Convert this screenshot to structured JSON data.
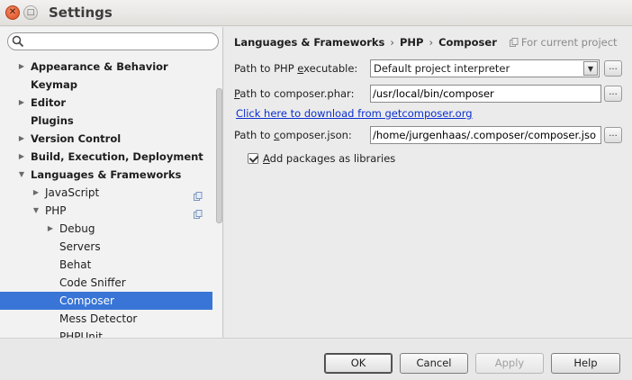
{
  "window": {
    "title": "Settings"
  },
  "search": {
    "placeholder": "",
    "value": ""
  },
  "tree": [
    {
      "label": "Appearance & Behavior",
      "bold": true,
      "level": 0,
      "arrow": "right"
    },
    {
      "label": "Keymap",
      "bold": true,
      "level": 0,
      "arrow": "none"
    },
    {
      "label": "Editor",
      "bold": true,
      "level": 0,
      "arrow": "right"
    },
    {
      "label": "Plugins",
      "bold": true,
      "level": 0,
      "arrow": "none"
    },
    {
      "label": "Version Control",
      "bold": true,
      "level": 0,
      "arrow": "right"
    },
    {
      "label": "Build, Execution, Deployment",
      "bold": true,
      "level": 0,
      "arrow": "right"
    },
    {
      "label": "Languages & Frameworks",
      "bold": true,
      "level": 0,
      "arrow": "down"
    },
    {
      "label": "JavaScript",
      "bold": false,
      "level": 1,
      "arrow": "right",
      "project_icon": true
    },
    {
      "label": "PHP",
      "bold": false,
      "level": 1,
      "arrow": "down",
      "project_icon": true
    },
    {
      "label": "Debug",
      "bold": false,
      "level": 2,
      "arrow": "right"
    },
    {
      "label": "Servers",
      "bold": false,
      "level": 2,
      "arrow": "none"
    },
    {
      "label": "Behat",
      "bold": false,
      "level": 2,
      "arrow": "none"
    },
    {
      "label": "Code Sniffer",
      "bold": false,
      "level": 2,
      "arrow": "none"
    },
    {
      "label": "Composer",
      "bold": false,
      "level": 2,
      "arrow": "none",
      "selected": true
    },
    {
      "label": "Mess Detector",
      "bold": false,
      "level": 2,
      "arrow": "none"
    },
    {
      "label": "PHPUnit",
      "bold": false,
      "level": 2,
      "arrow": "none"
    }
  ],
  "breadcrumb": {
    "items": [
      "Languages & Frameworks",
      "PHP",
      "Composer"
    ],
    "separator": "›",
    "scope": "For current project"
  },
  "form": {
    "php_executable": {
      "label_pre": "Path to PHP ",
      "label_mn": "e",
      "label_post": "xecutable:",
      "value": "Default project interpreter"
    },
    "composer_phar": {
      "label_mn": "P",
      "label_post": "ath to composer.phar:",
      "value": "/usr/local/bin/composer"
    },
    "download_link": "Click here to download from getcomposer.org",
    "composer_json": {
      "label_pre": "Path to ",
      "label_mn": "c",
      "label_post": "omposer.json:",
      "value": "/home/jurgenhaas/.composer/composer.json"
    },
    "add_packages": {
      "label_mn": "A",
      "label_post": "dd packages as libraries",
      "checked": true
    },
    "browse_label": "..."
  },
  "buttons": {
    "ok": "OK",
    "cancel": "Cancel",
    "apply": "Apply",
    "help": "Help"
  },
  "colors": {
    "selection": "#3875d7",
    "link": "#0b2fd1",
    "close_button": "#dd4b1e"
  }
}
